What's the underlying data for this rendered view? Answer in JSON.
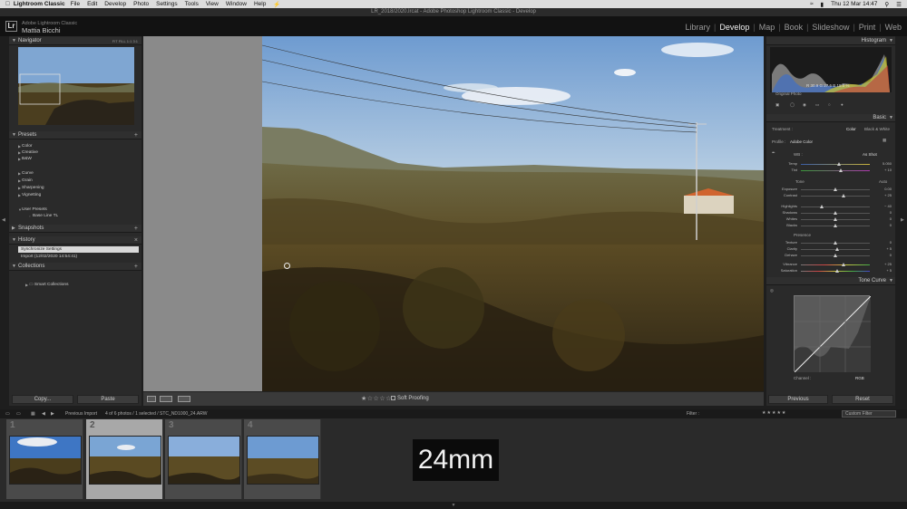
{
  "menubar": {
    "app_name": "Lightroom Classic",
    "items": [
      "File",
      "Edit",
      "Develop",
      "Photo",
      "Settings",
      "Tools",
      "View",
      "Window",
      "Help"
    ],
    "clock": "Thu 12 Mar  14:47"
  },
  "window_title": "LR_2018/2020.lrcat - Adobe Photoshop Lightroom Classic - Develop",
  "identity": {
    "product": "Adobe Lightroom Classic",
    "user": "Mattia Bicchi",
    "logo": "Lr"
  },
  "modules": {
    "items": [
      "Library",
      "Develop",
      "Map",
      "Book",
      "Slideshow",
      "Print",
      "Web"
    ],
    "active": "Develop",
    "separator": "|"
  },
  "navigator": {
    "title": "Navigator",
    "zoom_options": [
      "FIT",
      "FILL",
      "1:1",
      "3:1"
    ]
  },
  "presets": {
    "title": "Presets",
    "items": [
      "Color",
      "Creative",
      "B&W",
      "Curve",
      "Grain",
      "Sharpening",
      "Vignetting",
      "User Presets",
      "Base Line TL"
    ]
  },
  "snapshots": {
    "title": "Snapshots"
  },
  "history": {
    "title": "History",
    "items": [
      "Synchronize Settings",
      "Import (12/02/2020 14:54:41)"
    ]
  },
  "collections": {
    "title": "Collections",
    "items": [
      "Smart Collections"
    ]
  },
  "left_buttons": {
    "copy": "Copy...",
    "paste": "Paste"
  },
  "toolbar": {
    "soft_proofing": "Soft Proofing"
  },
  "histogram": {
    "title": "Histogram",
    "readout": "R  30.9   G  27.6   B  18.0 %",
    "original_photo": "Original Photo"
  },
  "basic": {
    "title": "Basic",
    "treatment_label": "Treatment :",
    "treatment_color": "Color",
    "treatment_bw": "Black & White",
    "profile_label": "Profile :",
    "profile_value": "Adobe Color",
    "wb_label": "WB :",
    "wb_value": "As Shot",
    "tone_label": "Tone",
    "auto_label": "Auto",
    "presence_label": "Presence",
    "sliders": [
      {
        "label": "Temp",
        "value": "5.050",
        "pos": 0.55
      },
      {
        "label": "Tint",
        "value": "+ 10",
        "pos": 0.58
      },
      {
        "label": "Exposure",
        "value": "0.00",
        "pos": 0.5
      },
      {
        "label": "Contrast",
        "value": "+ 25",
        "pos": 0.62
      },
      {
        "label": "Highlights",
        "value": "− 40",
        "pos": 0.3
      },
      {
        "label": "Shadows",
        "value": "0",
        "pos": 0.5
      },
      {
        "label": "Whites",
        "value": "0",
        "pos": 0.5
      },
      {
        "label": "Blacks",
        "value": "0",
        "pos": 0.5
      },
      {
        "label": "Texture",
        "value": "0",
        "pos": 0.5
      },
      {
        "label": "Clarity",
        "value": "+ 5",
        "pos": 0.53
      },
      {
        "label": "Dehaze",
        "value": "0",
        "pos": 0.5
      },
      {
        "label": "Vibrance",
        "value": "+ 25",
        "pos": 0.62
      },
      {
        "label": "Saturation",
        "value": "+ 5",
        "pos": 0.53
      }
    ]
  },
  "tone_curve": {
    "title": "Tone Curve",
    "channel_label": "Channel :",
    "channel_value": "RGB"
  },
  "right_buttons": {
    "previous": "Previous",
    "reset": "Reset"
  },
  "filmstrip_bar": {
    "source": "Previous Import",
    "info": "4 of 6 photos / 1 selected / STC_ND1000_24.ARW",
    "filter_label": "Filter :",
    "filter_preset": "Custom Filter"
  },
  "filmstrip": {
    "cells": [
      {
        "num": "1"
      },
      {
        "num": "2"
      },
      {
        "num": "3"
      },
      {
        "num": "4"
      }
    ],
    "selected_index": 1
  },
  "overlay": {
    "focal_length": "24mm"
  },
  "colors": {
    "panel": "#2a2a2a",
    "active_module": "#f0f0f0",
    "sky": "#8fb2d6",
    "foliage": "#5a4a22"
  }
}
